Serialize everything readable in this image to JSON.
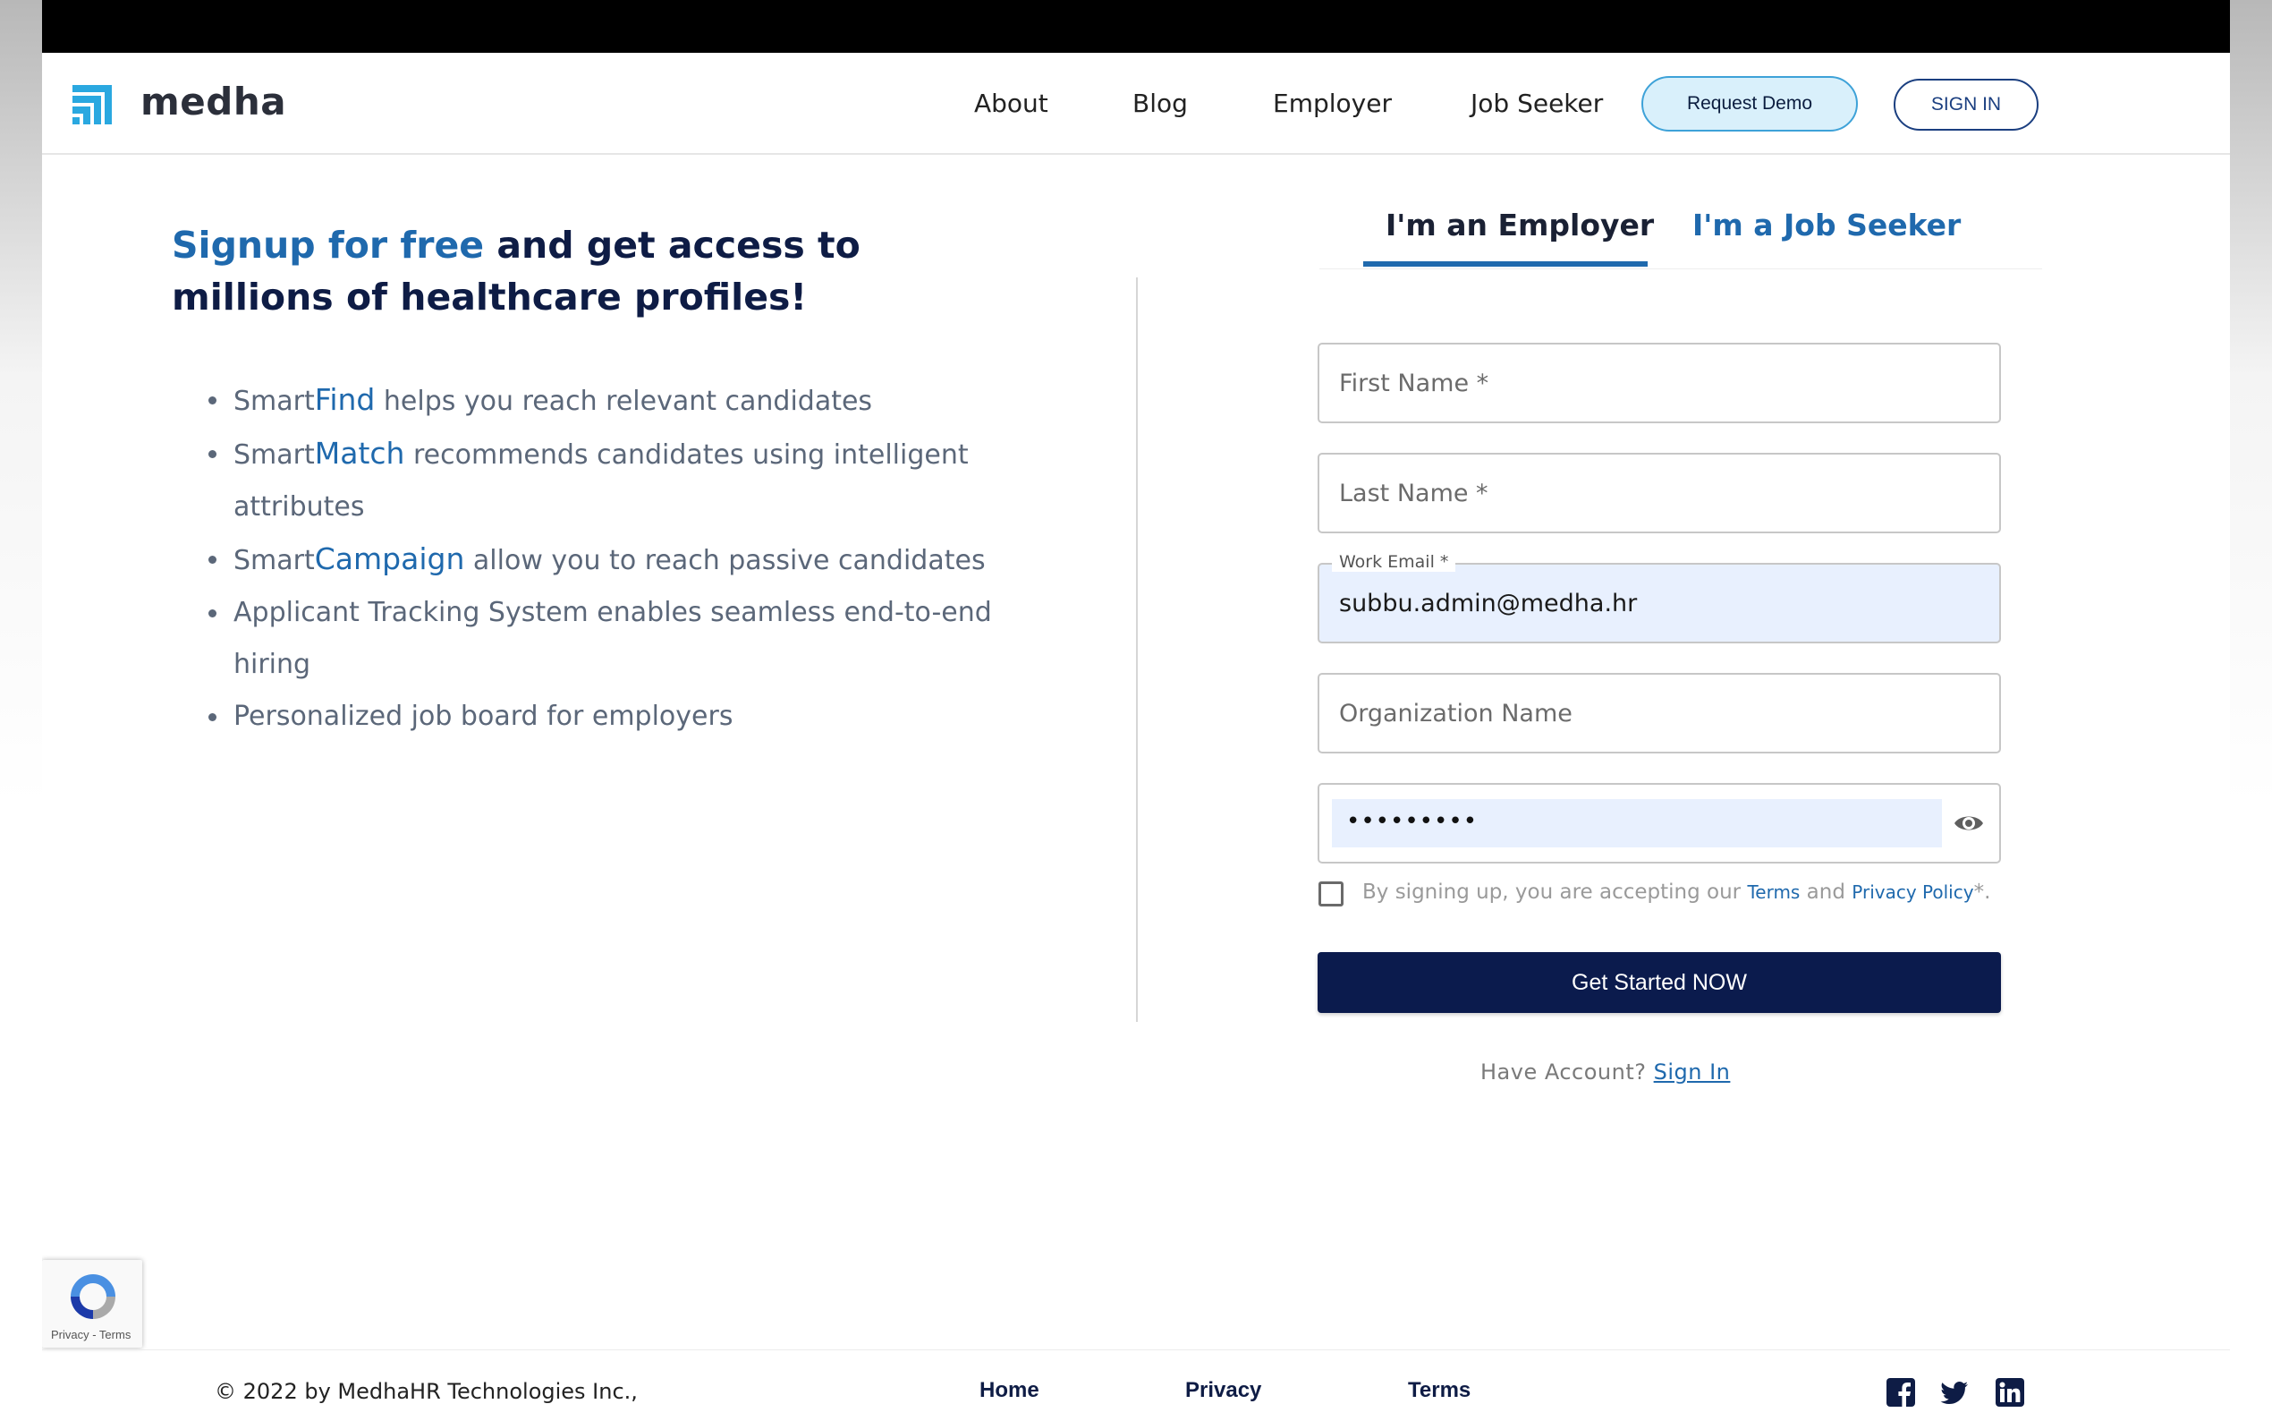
{
  "header": {
    "brand": "medha",
    "nav": [
      "About",
      "Blog",
      "Employer",
      "Job Seeker"
    ],
    "request_demo": "Request Demo",
    "sign_in": "SIGN IN"
  },
  "hero": {
    "headline_accent": "Signup for free",
    "headline_rest": " and get access to millions of healthcare profiles!",
    "features": [
      {
        "prefix": "Smart",
        "highlight": "Find",
        "text": " helps you reach relevant candidates"
      },
      {
        "prefix": "Smart",
        "highlight": "Match",
        "text": " recommends candidates using intelligent attributes"
      },
      {
        "prefix": "Smart",
        "highlight": "Campaign",
        "text": " allow you to reach passive candidates"
      },
      {
        "prefix": "",
        "highlight": "",
        "text": "Applicant Tracking System enables seamless end-to-end hiring"
      },
      {
        "prefix": "",
        "highlight": "",
        "text": "Personalized job board for employers"
      }
    ]
  },
  "tabs": {
    "employer": "I'm an Employer",
    "job_seeker": "I'm a Job Seeker"
  },
  "form": {
    "first_name_placeholder": "First Name *",
    "last_name_placeholder": "Last Name *",
    "email_label": "Work Email *",
    "email_value": "subbu.admin@medha.hr",
    "org_placeholder": "Organization Name",
    "password_mask": "•••••••••",
    "terms_prefix": "By signing up, you are accepting our ",
    "terms_link": "Terms",
    "terms_and": " and ",
    "privacy_link": "Privacy Policy",
    "terms_suffix": "*.",
    "submit": "Get Started NOW",
    "have_account": "Have Account? ",
    "sign_in_link": "Sign In"
  },
  "recaptcha": {
    "text": "Privacy - Terms"
  },
  "footer": {
    "copyright": "© 2022 by MedhaHR Technologies Inc.,",
    "links": [
      "Home",
      "Privacy",
      "Terms"
    ]
  },
  "colors": {
    "navy": "#0b1b4d",
    "accent_blue": "#1f69ad",
    "demo_bg": "#d9f0fb",
    "autofill_bg": "#e8f0fe"
  }
}
